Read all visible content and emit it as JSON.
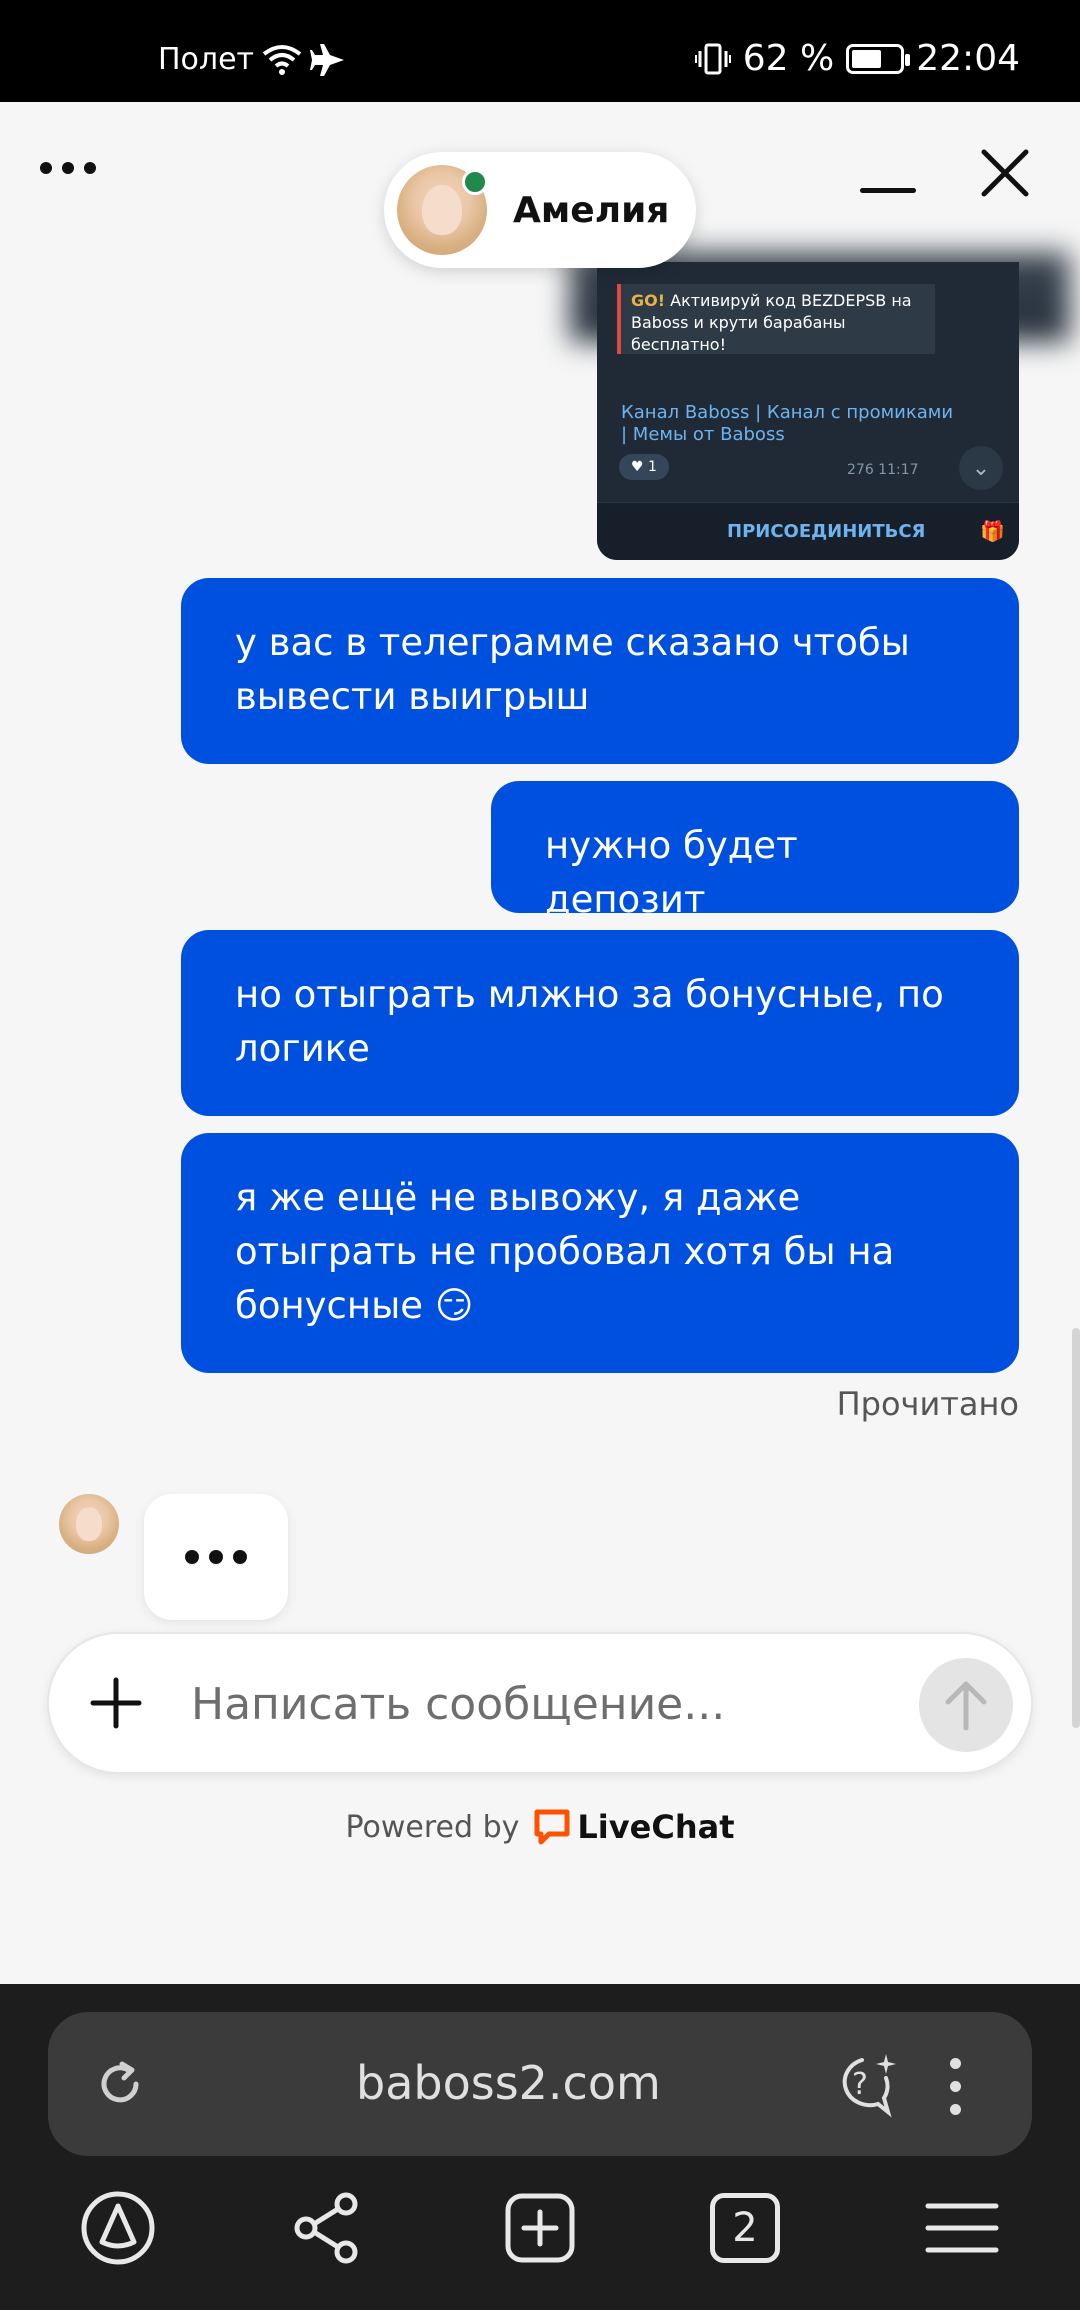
{
  "status_bar": {
    "carrier": "Полет",
    "battery": "62 %",
    "battery_level": 0.62,
    "time": "22:04"
  },
  "chat_header": {
    "agent_name": "Амелия"
  },
  "telegram_preview": {
    "quote_highlight": "GO!",
    "quote_text": "Активируй код BEZDEPSB на Baboss и крути барабаны бесплатно!",
    "links": "Канал Baboss | Канал с промиками | Мемы от Baboss",
    "reaction": "♥ 1",
    "meta": "276  11:17",
    "join_label": "ПРИСОЕДИНИТЬСЯ"
  },
  "messages": [
    {
      "text": "у вас в телеграмме сказано чтобы вывести выигрыш"
    },
    {
      "text": "нужно будет депозит"
    },
    {
      "text": "но отыграть млжно за бонусные, по логике"
    },
    {
      "text": "я же ещё не вывожу, я даже отыграть не пробовал хотя бы на бонусные 😏"
    }
  ],
  "read_receipt": "Прочитано",
  "composer": {
    "placeholder": "Написать сообщение..."
  },
  "footer": {
    "powered_by": "Powered by",
    "brand": "LiveChat"
  },
  "browser": {
    "url": "baboss2.com",
    "tab_count": "2"
  },
  "colors": {
    "bubble": "#0050e0",
    "online": "#1f8a4c",
    "livechat_orange": "#ff5100"
  }
}
